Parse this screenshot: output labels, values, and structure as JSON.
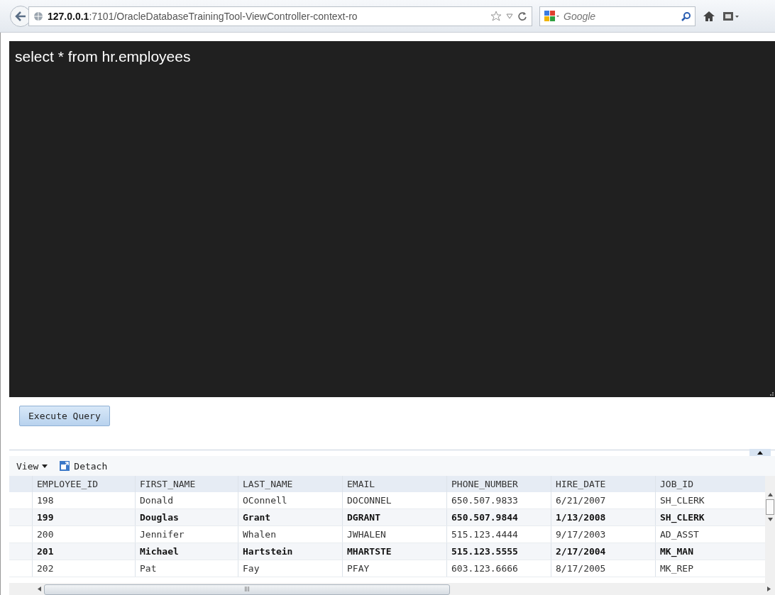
{
  "browser": {
    "url_host": "127.0.0.1",
    "url_rest": ":7101/OracleDatabaseTrainingTool-ViewController-context-ro",
    "search_placeholder": "Google"
  },
  "editor": {
    "value": "select * from hr.employees"
  },
  "execute_button": "Execute Query",
  "table_toolbar": {
    "view_menu": "View",
    "detach_button": "Detach"
  },
  "table": {
    "columns": [
      "EMPLOYEE_ID",
      "FIRST_NAME",
      "LAST_NAME",
      "EMAIL",
      "PHONE_NUMBER",
      "HIRE_DATE",
      "JOB_ID"
    ],
    "rows": [
      {
        "bold": false,
        "cells": [
          "198",
          "Donald",
          "OConnell",
          "DOCONNEL",
          "650.507.9833",
          "6/21/2007",
          "SH_CLERK"
        ]
      },
      {
        "bold": true,
        "cells": [
          "199",
          "Douglas",
          "Grant",
          "DGRANT",
          "650.507.9844",
          "1/13/2008",
          "SH_CLERK"
        ]
      },
      {
        "bold": false,
        "cells": [
          "200",
          "Jennifer",
          "Whalen",
          "JWHALEN",
          "515.123.4444",
          "9/17/2003",
          "AD_ASST"
        ]
      },
      {
        "bold": true,
        "cells": [
          "201",
          "Michael",
          "Hartstein",
          "MHARTSTE",
          "515.123.5555",
          "2/17/2004",
          "MK_MAN"
        ]
      },
      {
        "bold": false,
        "cells": [
          "202",
          "Pat",
          "Fay",
          "PFAY",
          "603.123.6666",
          "8/17/2005",
          "MK_REP"
        ]
      }
    ]
  },
  "hscroll_grip": "III"
}
